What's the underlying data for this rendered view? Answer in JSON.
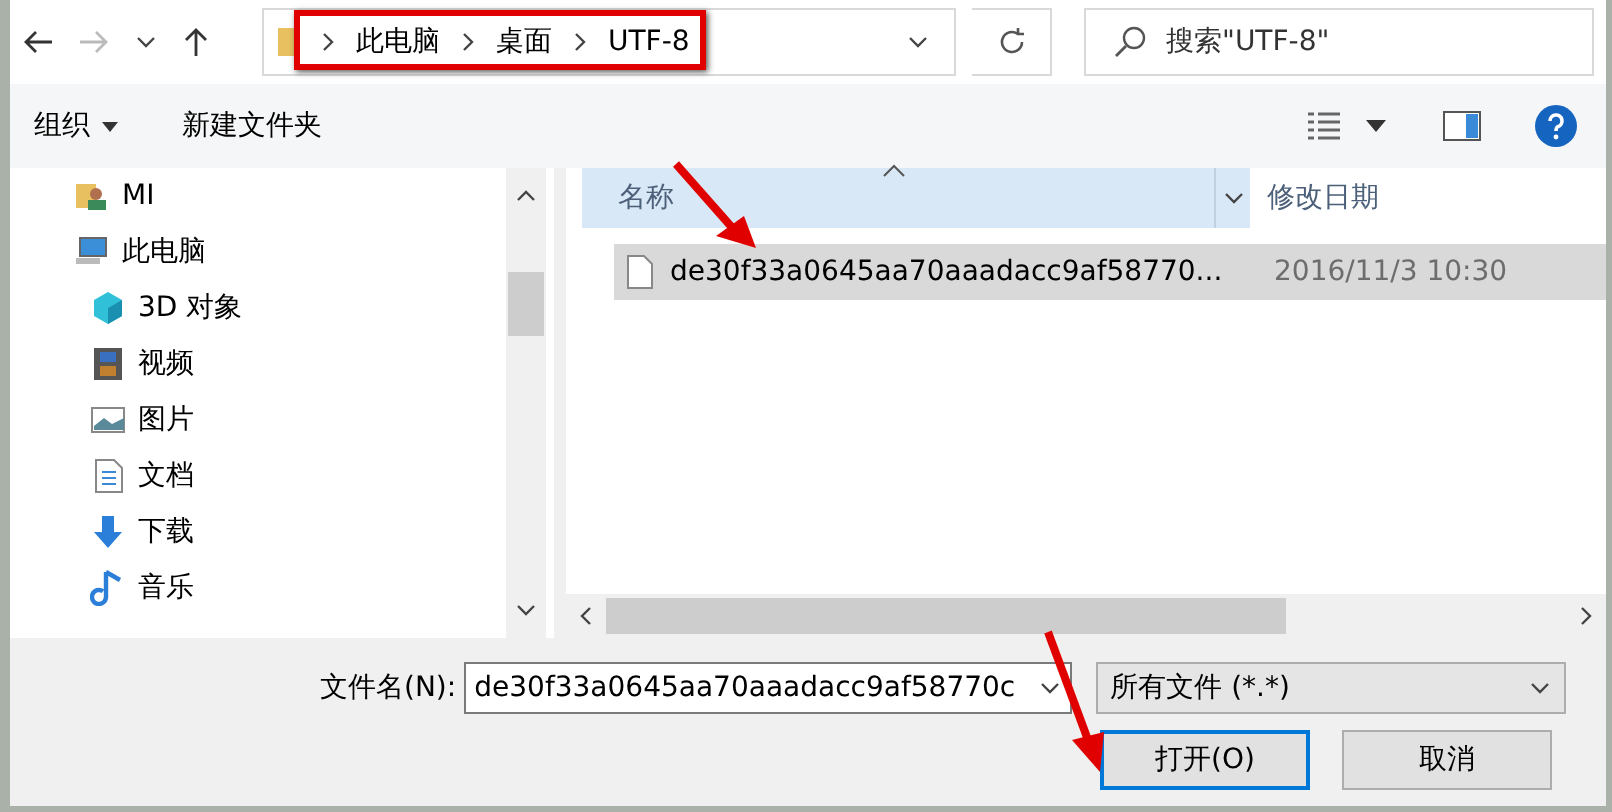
{
  "address_bar": {
    "breadcrumbs": [
      "此电脑",
      "桌面",
      "UTF-8"
    ]
  },
  "search": {
    "placeholder": "搜索\"UTF-8\""
  },
  "toolbar": {
    "organize": "组织",
    "new_folder": "新建文件夹"
  },
  "sidebar": {
    "items": [
      {
        "label": "MI"
      },
      {
        "label": "此电脑",
        "children": [
          {
            "label": "3D 对象"
          },
          {
            "label": "视频"
          },
          {
            "label": "图片"
          },
          {
            "label": "文档"
          },
          {
            "label": "下载"
          },
          {
            "label": "音乐"
          }
        ]
      }
    ]
  },
  "file_list": {
    "columns": [
      {
        "label": "名称",
        "sorted": true
      },
      {
        "label": "修改日期",
        "sorted": false
      }
    ],
    "rows": [
      {
        "name": "de30f33a0645aa70aaadacc9af58770...",
        "modified": "2016/11/3 10:30",
        "selected": true
      }
    ]
  },
  "footer": {
    "filename_label": "文件名(N):",
    "filename_value": "de30f33a0645aa70aaadacc9af58770c",
    "filetype": "所有文件 (*.*)",
    "buttons": [
      {
        "label": "打开(O)",
        "kind": "primary"
      },
      {
        "label": "取消",
        "kind": "secondary"
      }
    ]
  }
}
